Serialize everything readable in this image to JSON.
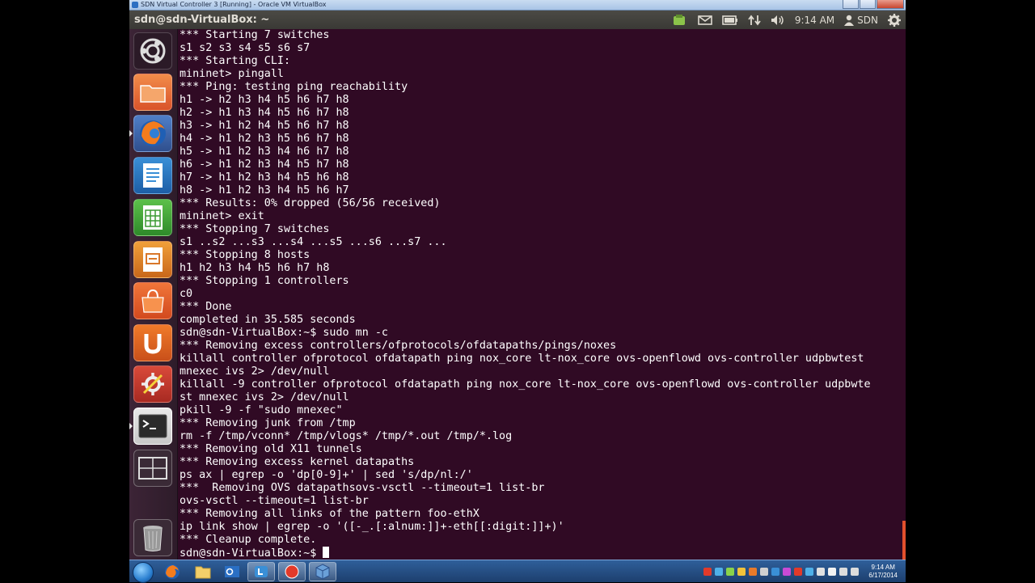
{
  "vbox_window": {
    "title": "SDN Virtual Controller 3 [Running] - Oracle VM VirtualBox"
  },
  "top_panel": {
    "title": "sdn@sdn-VirtualBox: ~",
    "time": "9:14 AM",
    "user": "SDN"
  },
  "launcher": {
    "items": [
      {
        "name": "dash-home",
        "icon": "ubuntu-logo-icon"
      },
      {
        "name": "files",
        "icon": "folder-icon"
      },
      {
        "name": "firefox",
        "icon": "firefox-icon"
      },
      {
        "name": "libreoffice-writer",
        "icon": "writer-icon"
      },
      {
        "name": "libreoffice-calc",
        "icon": "calc-icon"
      },
      {
        "name": "libreoffice-impress",
        "icon": "impress-icon"
      },
      {
        "name": "software-center",
        "icon": "shopping-bag-icon"
      },
      {
        "name": "ubuntu-one",
        "icon": "ubuntu-one-icon"
      },
      {
        "name": "system-settings",
        "icon": "settings-icon"
      },
      {
        "name": "terminal",
        "icon": "terminal-icon"
      },
      {
        "name": "workspaces",
        "icon": "workspace-switcher-icon"
      },
      {
        "name": "trash",
        "icon": "trash-icon"
      }
    ]
  },
  "terminal": {
    "lines": [
      "*** Starting 7 switches",
      "s1 s2 s3 s4 s5 s6 s7",
      "*** Starting CLI:",
      "mininet> pingall",
      "*** Ping: testing ping reachability",
      "h1 -> h2 h3 h4 h5 h6 h7 h8",
      "h2 -> h1 h3 h4 h5 h6 h7 h8",
      "h3 -> h1 h2 h4 h5 h6 h7 h8",
      "h4 -> h1 h2 h3 h5 h6 h7 h8",
      "h5 -> h1 h2 h3 h4 h6 h7 h8",
      "h6 -> h1 h2 h3 h4 h5 h7 h8",
      "h7 -> h1 h2 h3 h4 h5 h6 h8",
      "h8 -> h1 h2 h3 h4 h5 h6 h7",
      "*** Results: 0% dropped (56/56 received)",
      "mininet> exit",
      "*** Stopping 7 switches",
      "s1 ..s2 ...s3 ...s4 ...s5 ...s6 ...s7 ...",
      "*** Stopping 8 hosts",
      "h1 h2 h3 h4 h5 h6 h7 h8",
      "*** Stopping 1 controllers",
      "c0",
      "*** Done",
      "completed in 35.585 seconds",
      "sdn@sdn-VirtualBox:~$ sudo mn -c",
      "*** Removing excess controllers/ofprotocols/ofdatapaths/pings/noxes",
      "killall controller ofprotocol ofdatapath ping nox_core lt-nox_core ovs-openflowd ovs-controller udpbwtest",
      "mnexec ivs 2> /dev/null",
      "killall -9 controller ofprotocol ofdatapath ping nox_core lt-nox_core ovs-openflowd ovs-controller udpbwte",
      "st mnexec ivs 2> /dev/null",
      "pkill -9 -f \"sudo mnexec\"",
      "*** Removing junk from /tmp",
      "rm -f /tmp/vconn* /tmp/vlogs* /tmp/*.out /tmp/*.log",
      "*** Removing old X11 tunnels",
      "*** Removing excess kernel datapaths",
      "ps ax | egrep -o 'dp[0-9]+' | sed 's/dp/nl:/'",
      "***  Removing OVS datapathsovs-vsctl --timeout=1 list-br",
      "ovs-vsctl --timeout=1 list-br",
      "*** Removing all links of the pattern foo-ethX",
      "ip link show | egrep -o '([-_.[:alnum:]]+-eth[[:digit:]]+)'",
      "*** Cleanup complete.",
      "sdn@sdn-VirtualBox:~$ "
    ]
  },
  "taskbar": {
    "clock_time": "9:14 AM",
    "clock_date": "6/17/2014"
  }
}
